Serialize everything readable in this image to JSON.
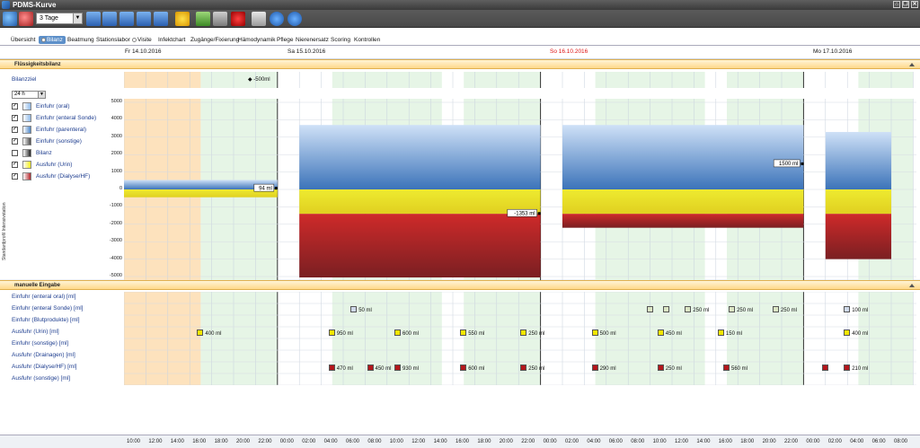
{
  "app": {
    "title": "PDMS-Kurve"
  },
  "toolbar": {
    "period": "3 Tage",
    "icons": [
      "zoom-in-icon",
      "zoom-out-icon",
      "first-icon",
      "back-icon",
      "forward-icon",
      "fast-forward-icon",
      "last-icon",
      "star-icon",
      "play-icon",
      "tools-icon",
      "alarm-icon",
      "print-icon",
      "help-icon",
      "info-icon"
    ]
  },
  "tabs": [
    "Übersicht",
    "Bilanz",
    "Beatmung",
    "Stationslabor",
    "Visite",
    "Infektchart",
    "Zugänge/Fixierung",
    "Hämodynamik",
    "Pflege",
    "Nierenersatz",
    "Scoring",
    "Kontrollen"
  ],
  "dates": [
    {
      "label": "Fr 14.10.2016",
      "red": false
    },
    {
      "label": "Sa 15.10.2016",
      "red": false
    },
    {
      "label": "So 16.10.2016",
      "red": true
    },
    {
      "label": "Mo 17.10.2016",
      "red": false
    }
  ],
  "section1": {
    "title": "Flüssigkeitsbilanz"
  },
  "bilanzziel": {
    "label": "Bilanzziel",
    "value": "-500ml"
  },
  "interval": "24 h",
  "ystrip_label": "Standardprofil Intensivstation",
  "legend": [
    {
      "label": "Einfuhr (oral)",
      "checked": true,
      "color": "#8fb9e8"
    },
    {
      "label": "Einfuhr (enteral Sonde)",
      "checked": true,
      "color": "#8fb9e8"
    },
    {
      "label": "Einfuhr (parenteral)",
      "checked": true,
      "color": "#4e86c6"
    },
    {
      "label": "Einfuhr (sonstige)",
      "checked": true,
      "color": "#4a4a4a"
    },
    {
      "label": "Bilanz",
      "checked": false,
      "color": "#222222"
    },
    {
      "label": "Ausfuhr (Urin)",
      "checked": true,
      "color": "#f2ec1a"
    },
    {
      "label": "Ausfuhr (Dialyse/HF)",
      "checked": true,
      "color": "#b2262b"
    }
  ],
  "chart_data": {
    "type": "bar",
    "ylim": [
      -5000,
      5000
    ],
    "yticks": [
      5000,
      4000,
      3000,
      2000,
      1000,
      0,
      -1000,
      -2000,
      -3000,
      -4000,
      -5000
    ],
    "xticks": [
      "10:00",
      "12:00",
      "14:00",
      "16:00",
      "18:00",
      "20:00",
      "22:00",
      "00:00",
      "02:00",
      "04:00",
      "06:00",
      "08:00",
      "10:00",
      "12:00",
      "14:00",
      "16:00",
      "18:00",
      "20:00",
      "22:00",
      "00:00",
      "02:00",
      "04:00",
      "06:00",
      "08:00",
      "10:00",
      "12:00",
      "14:00",
      "16:00",
      "18:00",
      "20:00",
      "22:00",
      "00:00",
      "02:00",
      "04:00",
      "06:00",
      "08:00"
    ],
    "bars": [
      {
        "start_hour": 0,
        "end_hour": 14,
        "einfuhr": 544,
        "ausfuhr": -450,
        "bilanz_label": "94 ml"
      },
      {
        "start_hour": 16,
        "end_hour": 38,
        "einfuhr": 3700,
        "ausfuhr": -5053,
        "bilanz_label": "-1353 ml"
      },
      {
        "start_hour": 40,
        "end_hour": 62,
        "einfuhr": 3700,
        "ausfuhr": -2200,
        "bilanz_label": "1500 ml"
      },
      {
        "start_hour": 64,
        "end_hour": 70,
        "einfuhr": 3300,
        "ausfuhr": -4000,
        "bilanz_label": ""
      }
    ]
  },
  "section2": {
    "title": "manuelle Eingabe"
  },
  "manual_rows": [
    "Einfuhr (enteral oral) [ml]",
    "Einfuhr (enteral Sonde) [ml]",
    "Einfuhr (Blutprodukte) [ml]",
    "Ausfuhr (Urin) [ml]",
    "Einfuhr (sonstige) [ml]",
    "Ausfuhr (Drainagen) [ml]",
    "Ausfuhr (Dialyse/HF) [ml]",
    "Ausfuhr (sonstige) [ml]"
  ],
  "entries": [
    {
      "row": 1,
      "hour": 21,
      "value": "50 ml",
      "color": "#cfd9ea"
    },
    {
      "row": 1,
      "hour": 48,
      "value": "",
      "color": "#dbe6c4"
    },
    {
      "row": 1,
      "hour": 49.5,
      "value": "",
      "color": "#dbe6c4"
    },
    {
      "row": 1,
      "hour": 51.5,
      "value": "250 ml",
      "color": "#dbe6c4"
    },
    {
      "row": 1,
      "hour": 55.5,
      "value": "250 ml",
      "color": "#dbe6c4"
    },
    {
      "row": 1,
      "hour": 59.5,
      "value": "250 ml",
      "color": "#dbe6c4"
    },
    {
      "row": 1,
      "hour": 66,
      "value": "100 ml",
      "color": "#cfd9ea"
    },
    {
      "row": 3,
      "hour": 7,
      "value": "400 ml",
      "color": "#f2e600"
    },
    {
      "row": 3,
      "hour": 19,
      "value": "950 ml",
      "color": "#f2e600"
    },
    {
      "row": 3,
      "hour": 25,
      "value": "600 ml",
      "color": "#f2e600"
    },
    {
      "row": 3,
      "hour": 31,
      "value": "550 ml",
      "color": "#f2e600"
    },
    {
      "row": 3,
      "hour": 36.5,
      "value": "250 ml",
      "color": "#f2e600"
    },
    {
      "row": 3,
      "hour": 43,
      "value": "500 ml",
      "color": "#f2e600"
    },
    {
      "row": 3,
      "hour": 49,
      "value": "450 ml",
      "color": "#f2e600"
    },
    {
      "row": 3,
      "hour": 54.5,
      "value": "150 ml",
      "color": "#f2e600"
    },
    {
      "row": 3,
      "hour": 66,
      "value": "400 ml",
      "color": "#f2e600"
    },
    {
      "row": 6,
      "hour": 19,
      "value": "470 ml",
      "color": "#b3171c"
    },
    {
      "row": 6,
      "hour": 22.5,
      "value": "450 ml",
      "color": "#b3171c"
    },
    {
      "row": 6,
      "hour": 25,
      "value": "930 ml",
      "color": "#b3171c"
    },
    {
      "row": 6,
      "hour": 31,
      "value": "600 ml",
      "color": "#b3171c"
    },
    {
      "row": 6,
      "hour": 36.5,
      "value": "250 ml",
      "color": "#b3171c"
    },
    {
      "row": 6,
      "hour": 43,
      "value": "290 ml",
      "color": "#b3171c"
    },
    {
      "row": 6,
      "hour": 49,
      "value": "250 ml",
      "color": "#b3171c"
    },
    {
      "row": 6,
      "hour": 55,
      "value": "560 ml",
      "color": "#b3171c"
    },
    {
      "row": 6,
      "hour": 64,
      "value": "",
      "color": "#b3171c"
    },
    {
      "row": 6,
      "hour": 66,
      "value": "210 ml",
      "color": "#b3171c"
    }
  ]
}
